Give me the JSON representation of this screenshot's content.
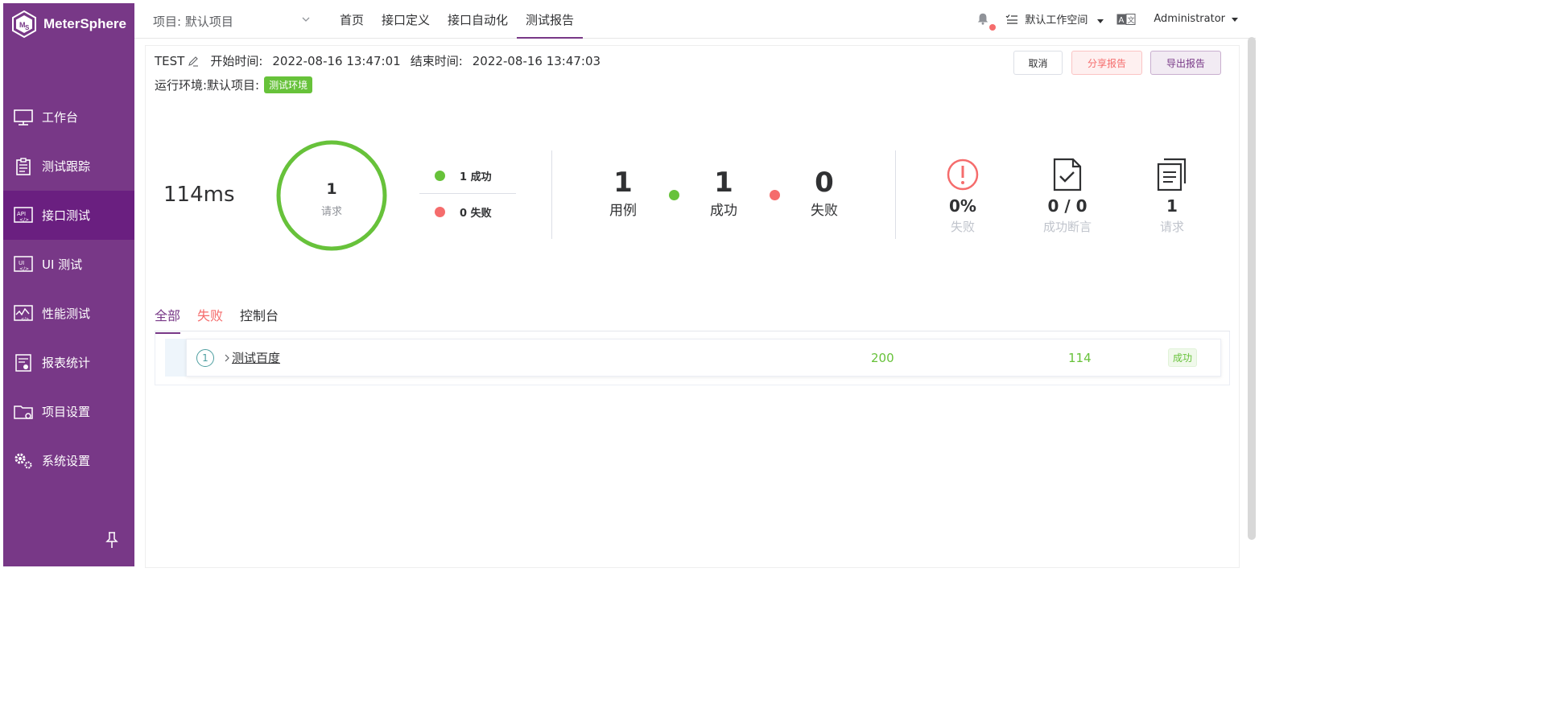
{
  "app": {
    "name": "MeterSphere"
  },
  "sidebar": {
    "items": [
      {
        "label": "工作台",
        "icon": "monitor-icon"
      },
      {
        "label": "测试跟踪",
        "icon": "clipboard-icon"
      },
      {
        "label": "接口测试",
        "icon": "api-icon",
        "active": true
      },
      {
        "label": "UI 测试",
        "icon": "ui-icon"
      },
      {
        "label": "性能测试",
        "icon": "performance-icon"
      },
      {
        "label": "报表统计",
        "icon": "report-icon"
      },
      {
        "label": "项目设置",
        "icon": "folder-gear-icon"
      },
      {
        "label": "系统设置",
        "icon": "gears-icon"
      }
    ]
  },
  "topbar": {
    "project": "项目: 默认项目",
    "nav": [
      "首页",
      "接口定义",
      "接口自动化",
      "测试报告"
    ],
    "active_nav": "测试报告",
    "workspace": "默认工作空间",
    "user": "Administrator"
  },
  "report": {
    "name": "TEST",
    "start_label": "开始时间:",
    "start_time": "2022-08-16 13:47:01",
    "end_label": "结束时间:",
    "end_time": "2022-08-16 13:47:03",
    "env_label": "运行环境:默认项目:",
    "env_tag": "测试环境",
    "buttons": {
      "cancel": "取消",
      "share": "分享报告",
      "export": "导出报告"
    }
  },
  "summary": {
    "duration": "114ms",
    "ring_count": "1",
    "ring_label": "请求",
    "ring_success_fraction": 1.0,
    "legend_success": "1 成功",
    "legend_fail": "0 失败",
    "cases": {
      "num": "1",
      "label": "用例"
    },
    "success": {
      "num": "1",
      "label": "成功"
    },
    "fail": {
      "num": "0",
      "label": "失败"
    },
    "fail_rate": {
      "num": "0%",
      "label": "失败"
    },
    "assertions": {
      "num": "0 / 0",
      "label": "成功断言"
    },
    "requests": {
      "num": "1",
      "label": "请求"
    }
  },
  "tabs": {
    "all": "全部",
    "fail": "失败",
    "console": "控制台"
  },
  "results": [
    {
      "index": "1",
      "name": "测试百度",
      "code": "200",
      "time": "114",
      "status": "成功"
    }
  ],
  "colors": {
    "brand": "#783887",
    "success": "#67c23a",
    "fail": "#f56c6c"
  }
}
